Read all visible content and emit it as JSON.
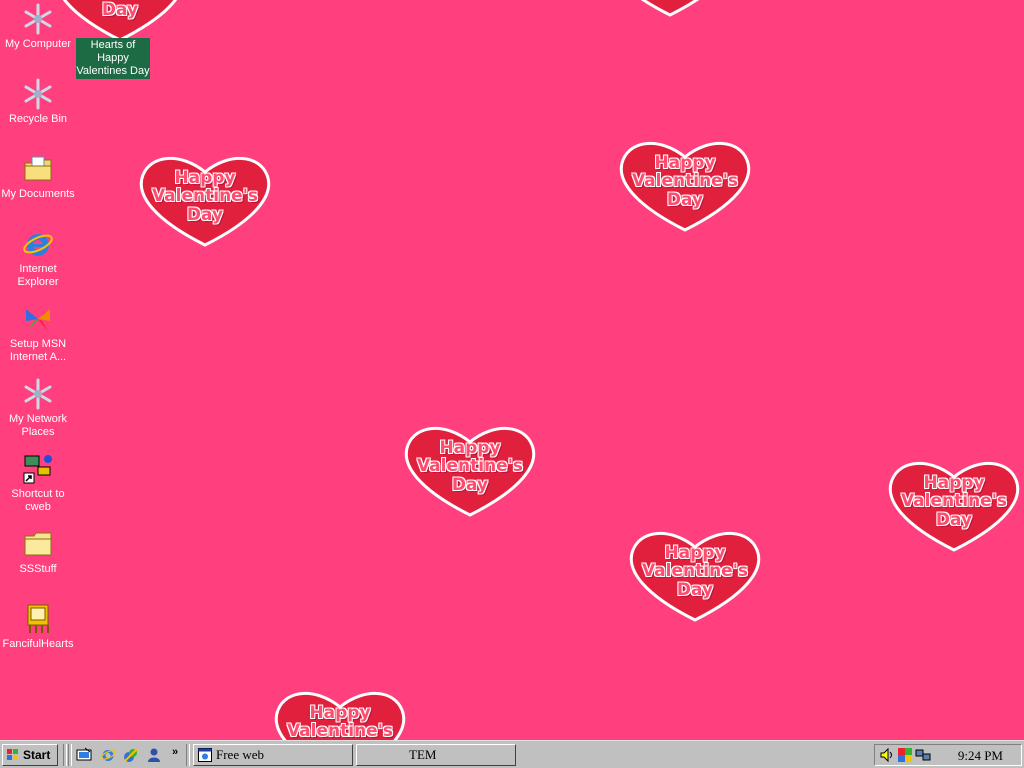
{
  "desktop_icons": [
    {
      "label": "My Computer",
      "icon": "snowflake-icon"
    },
    {
      "label": "Recycle Bin",
      "icon": "snowflake-icon"
    },
    {
      "label": "My Documents",
      "icon": "folder-documents-icon"
    },
    {
      "label": "Internet Explorer",
      "icon": "internet-explorer-icon"
    },
    {
      "label": "Setup MSN Internet A...",
      "icon": "msn-butterfly-icon"
    },
    {
      "label": "My Network Places",
      "icon": "snowflake-icon"
    },
    {
      "label": "Shortcut to cweb",
      "icon": "network-shortcut-icon"
    },
    {
      "label": "SSStuff",
      "icon": "folder-icon"
    },
    {
      "label": "FancifulHearts",
      "icon": "winzip-icon"
    }
  ],
  "selected_item": {
    "label": "Hearts of Happy Valentines Day"
  },
  "wallpaper": {
    "line1": "Happy",
    "line2": "Valentine's",
    "line3": "Day"
  },
  "taskbar": {
    "start_label": "Start",
    "more_glyph": "»",
    "tasks": [
      {
        "label": "Free web",
        "icon": "browser-window-icon"
      },
      {
        "label": "TEM",
        "icon": ""
      }
    ],
    "clock": "9:24 PM"
  },
  "colors": {
    "wallpaper": "#ff3f7e",
    "taskbar": "#c0c0c0",
    "selection": "#1d6b45"
  }
}
